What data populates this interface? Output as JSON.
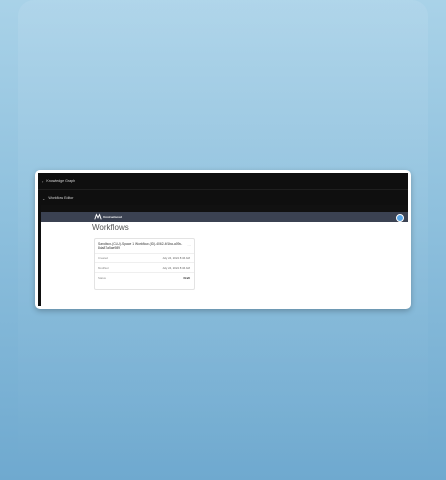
{
  "accordion": {
    "items": [
      {
        "label": "Knowledge Graph",
        "chevron": "chevron-right-icon"
      },
      {
        "label": "Workflow Editor",
        "chevron": "chevron-down-icon"
      }
    ]
  },
  "navbar": {
    "brand": "Unstructured",
    "logo_icon": "unstructured-logo-icon",
    "user_icon": "user-avatar-icon"
  },
  "page": {
    "title": "Workflows"
  },
  "workflow_card": {
    "title": "Sandbox-(CLU)-Space 1 Workflow-(ID)-4062-4f1ba-a09c-8da87a5ae989",
    "menu": "...",
    "created_label": "Created",
    "created_value": "July 24, 2024 8:46 AM",
    "modified_label": "Modified",
    "modified_value": "July 24, 2024 8:46 AM",
    "status_label": "Status",
    "status_value": "Draft"
  },
  "colors": {
    "navbar": "#3b4252",
    "accordion": "#0f0f0f",
    "accent": "#5aa6e6"
  }
}
